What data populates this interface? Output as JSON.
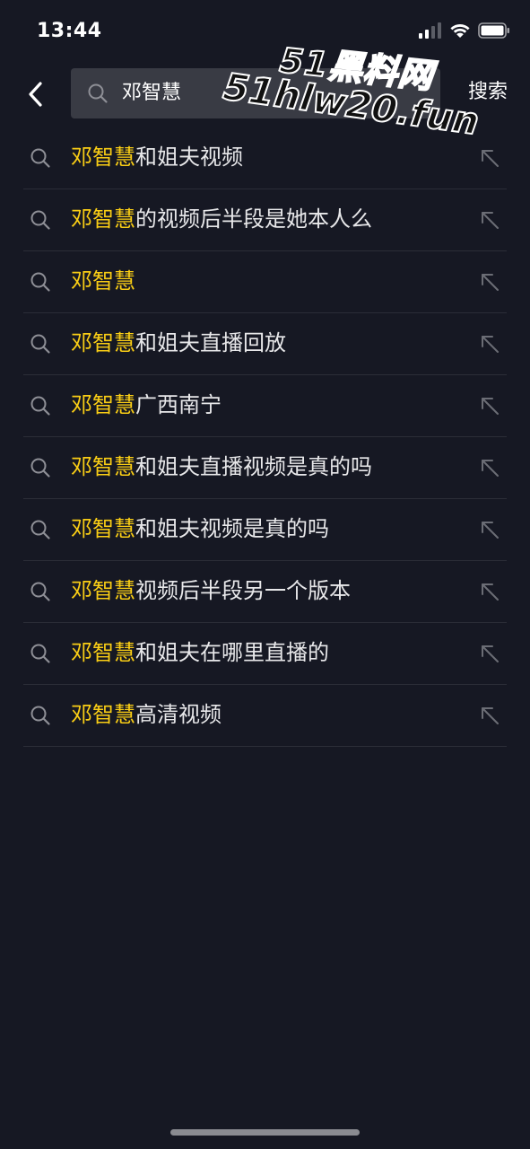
{
  "status_bar": {
    "time": "13:44",
    "icons": [
      "cellular-signal-icon",
      "wifi-icon",
      "battery-icon"
    ]
  },
  "header": {
    "back_icon": "chevron-left-icon",
    "search": {
      "icon": "search-icon",
      "value": "邓智慧"
    },
    "submit_label": "搜索"
  },
  "suggestions": [
    {
      "highlight": "邓智慧",
      "rest": "和姐夫视频"
    },
    {
      "highlight": "邓智慧",
      "rest": "的视频后半段是她本人么"
    },
    {
      "highlight": "邓智慧",
      "rest": ""
    },
    {
      "highlight": "邓智慧",
      "rest": "和姐夫直播回放"
    },
    {
      "highlight": "邓智慧",
      "rest": "广西南宁"
    },
    {
      "highlight": "邓智慧",
      "rest": "和姐夫直播视频是真的吗"
    },
    {
      "highlight": "邓智慧",
      "rest": "和姐夫视频是真的吗"
    },
    {
      "highlight": "邓智慧",
      "rest": "视频后半段另一个版本"
    },
    {
      "highlight": "邓智慧",
      "rest": "和姐夫在哪里直播的"
    },
    {
      "highlight": "邓智慧",
      "rest": "高清视频"
    }
  ],
  "suggestion_icons": {
    "leading": "search-icon",
    "trailing": "arrow-up-left-icon"
  },
  "watermark": {
    "line1": "51黑料网",
    "line2": "51hlw20.fun"
  },
  "colors": {
    "background": "#161823",
    "search_box": "#393b44",
    "highlight": "#face15",
    "text": "#e8e8ea",
    "divider": "#2b2d37"
  }
}
